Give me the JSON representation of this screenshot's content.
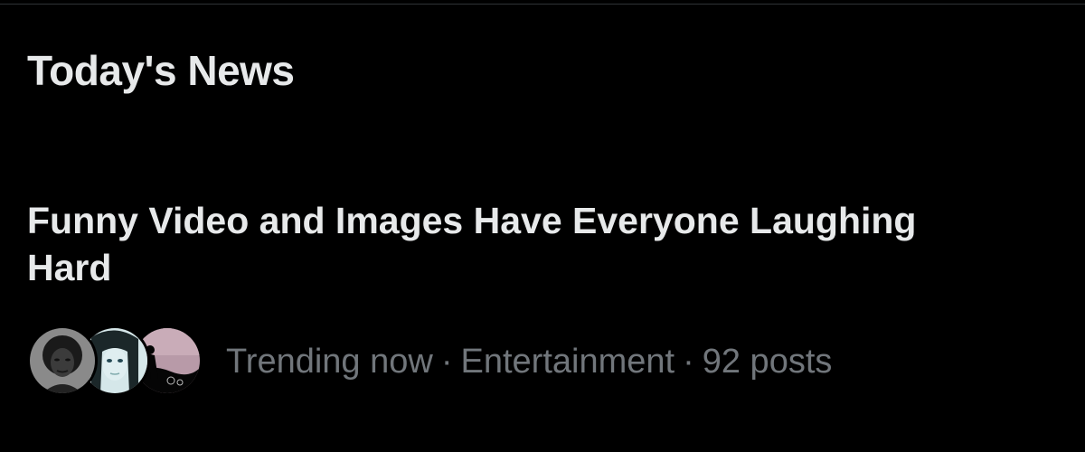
{
  "section": {
    "title": "Today's News"
  },
  "story": {
    "headline": "Funny Video and Images Have Everyone Laughing Hard",
    "meta": {
      "status": "Trending now",
      "separator": "·",
      "category": "Entertainment",
      "post_count": "92 posts"
    },
    "avatars": [
      "avatar-portrait-1",
      "avatar-portrait-2",
      "avatar-silhouette-3"
    ]
  },
  "colors": {
    "background": "#000000",
    "primary_text": "#e7e9ea",
    "secondary_text": "#71767b",
    "divider": "#2f3336"
  }
}
